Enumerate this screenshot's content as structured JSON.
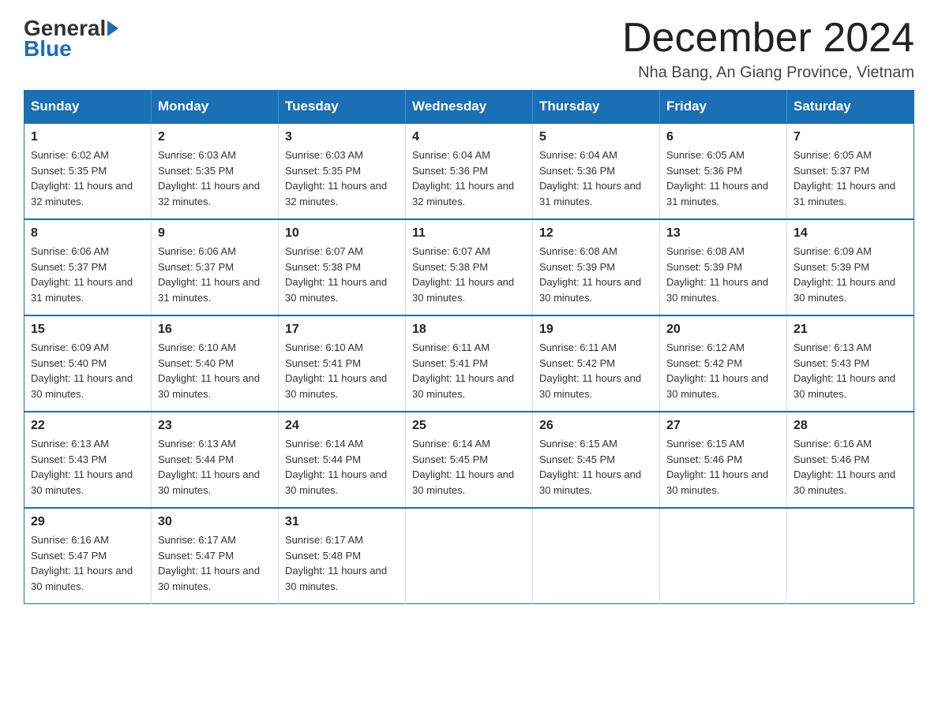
{
  "logo": {
    "general": "General",
    "blue": "Blue"
  },
  "title": "December 2024",
  "location": "Nha Bang, An Giang Province, Vietnam",
  "days_of_week": [
    "Sunday",
    "Monday",
    "Tuesday",
    "Wednesday",
    "Thursday",
    "Friday",
    "Saturday"
  ],
  "weeks": [
    [
      {
        "day": "1",
        "sunrise": "6:02 AM",
        "sunset": "5:35 PM",
        "daylight": "11 hours and 32 minutes."
      },
      {
        "day": "2",
        "sunrise": "6:03 AM",
        "sunset": "5:35 PM",
        "daylight": "11 hours and 32 minutes."
      },
      {
        "day": "3",
        "sunrise": "6:03 AM",
        "sunset": "5:35 PM",
        "daylight": "11 hours and 32 minutes."
      },
      {
        "day": "4",
        "sunrise": "6:04 AM",
        "sunset": "5:36 PM",
        "daylight": "11 hours and 32 minutes."
      },
      {
        "day": "5",
        "sunrise": "6:04 AM",
        "sunset": "5:36 PM",
        "daylight": "11 hours and 31 minutes."
      },
      {
        "day": "6",
        "sunrise": "6:05 AM",
        "sunset": "5:36 PM",
        "daylight": "11 hours and 31 minutes."
      },
      {
        "day": "7",
        "sunrise": "6:05 AM",
        "sunset": "5:37 PM",
        "daylight": "11 hours and 31 minutes."
      }
    ],
    [
      {
        "day": "8",
        "sunrise": "6:06 AM",
        "sunset": "5:37 PM",
        "daylight": "11 hours and 31 minutes."
      },
      {
        "day": "9",
        "sunrise": "6:06 AM",
        "sunset": "5:37 PM",
        "daylight": "11 hours and 31 minutes."
      },
      {
        "day": "10",
        "sunrise": "6:07 AM",
        "sunset": "5:38 PM",
        "daylight": "11 hours and 30 minutes."
      },
      {
        "day": "11",
        "sunrise": "6:07 AM",
        "sunset": "5:38 PM",
        "daylight": "11 hours and 30 minutes."
      },
      {
        "day": "12",
        "sunrise": "6:08 AM",
        "sunset": "5:39 PM",
        "daylight": "11 hours and 30 minutes."
      },
      {
        "day": "13",
        "sunrise": "6:08 AM",
        "sunset": "5:39 PM",
        "daylight": "11 hours and 30 minutes."
      },
      {
        "day": "14",
        "sunrise": "6:09 AM",
        "sunset": "5:39 PM",
        "daylight": "11 hours and 30 minutes."
      }
    ],
    [
      {
        "day": "15",
        "sunrise": "6:09 AM",
        "sunset": "5:40 PM",
        "daylight": "11 hours and 30 minutes."
      },
      {
        "day": "16",
        "sunrise": "6:10 AM",
        "sunset": "5:40 PM",
        "daylight": "11 hours and 30 minutes."
      },
      {
        "day": "17",
        "sunrise": "6:10 AM",
        "sunset": "5:41 PM",
        "daylight": "11 hours and 30 minutes."
      },
      {
        "day": "18",
        "sunrise": "6:11 AM",
        "sunset": "5:41 PM",
        "daylight": "11 hours and 30 minutes."
      },
      {
        "day": "19",
        "sunrise": "6:11 AM",
        "sunset": "5:42 PM",
        "daylight": "11 hours and 30 minutes."
      },
      {
        "day": "20",
        "sunrise": "6:12 AM",
        "sunset": "5:42 PM",
        "daylight": "11 hours and 30 minutes."
      },
      {
        "day": "21",
        "sunrise": "6:13 AM",
        "sunset": "5:43 PM",
        "daylight": "11 hours and 30 minutes."
      }
    ],
    [
      {
        "day": "22",
        "sunrise": "6:13 AM",
        "sunset": "5:43 PM",
        "daylight": "11 hours and 30 minutes."
      },
      {
        "day": "23",
        "sunrise": "6:13 AM",
        "sunset": "5:44 PM",
        "daylight": "11 hours and 30 minutes."
      },
      {
        "day": "24",
        "sunrise": "6:14 AM",
        "sunset": "5:44 PM",
        "daylight": "11 hours and 30 minutes."
      },
      {
        "day": "25",
        "sunrise": "6:14 AM",
        "sunset": "5:45 PM",
        "daylight": "11 hours and 30 minutes."
      },
      {
        "day": "26",
        "sunrise": "6:15 AM",
        "sunset": "5:45 PM",
        "daylight": "11 hours and 30 minutes."
      },
      {
        "day": "27",
        "sunrise": "6:15 AM",
        "sunset": "5:46 PM",
        "daylight": "11 hours and 30 minutes."
      },
      {
        "day": "28",
        "sunrise": "6:16 AM",
        "sunset": "5:46 PM",
        "daylight": "11 hours and 30 minutes."
      }
    ],
    [
      {
        "day": "29",
        "sunrise": "6:16 AM",
        "sunset": "5:47 PM",
        "daylight": "11 hours and 30 minutes."
      },
      {
        "day": "30",
        "sunrise": "6:17 AM",
        "sunset": "5:47 PM",
        "daylight": "11 hours and 30 minutes."
      },
      {
        "day": "31",
        "sunrise": "6:17 AM",
        "sunset": "5:48 PM",
        "daylight": "11 hours and 30 minutes."
      },
      null,
      null,
      null,
      null
    ]
  ]
}
